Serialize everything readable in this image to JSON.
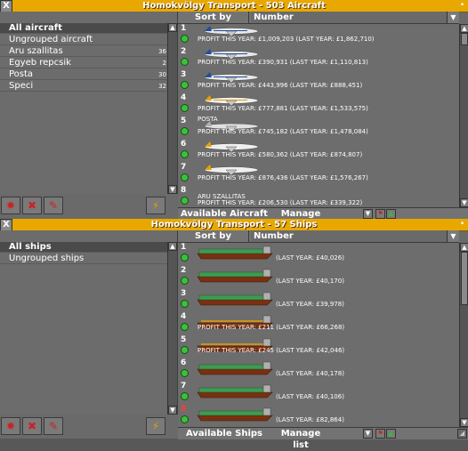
{
  "aircraft_window": {
    "title": "Homokvölgy Transport - 503 Aircraft",
    "close": "X",
    "pin": "•",
    "groups": [
      {
        "label": "All aircraft",
        "count": ""
      },
      {
        "label": "Ungrouped aircraft",
        "count": ""
      },
      {
        "label": "Aru szallitas",
        "count": "36"
      },
      {
        "label": "Egyeb repcsik",
        "count": "2"
      },
      {
        "label": "Posta",
        "count": "30"
      },
      {
        "label": "Speci",
        "count": "32"
      }
    ],
    "sort_by_label": "Sort by",
    "sort_value": "Number",
    "vehicles": [
      {
        "num": "1",
        "profit": "PROFIT THIS YEAR: £1,009,203 (LAST YEAR: £1,862,710)",
        "tag": ""
      },
      {
        "num": "2",
        "profit": "PROFIT THIS YEAR: £390,931 (LAST YEAR: £1,110,813)",
        "tag": ""
      },
      {
        "num": "3",
        "profit": "PROFIT THIS YEAR: £443,996 (LAST YEAR: £888,451)",
        "tag": ""
      },
      {
        "num": "4",
        "profit": "PROFIT THIS YEAR: £777,881 (LAST YEAR: £1,533,575)",
        "tag": ""
      },
      {
        "num": "5",
        "profit": "PROFIT THIS YEAR: £745,182 (LAST YEAR: £1,478,084)",
        "tag": "POSTA"
      },
      {
        "num": "6",
        "profit": "PROFIT THIS YEAR: £580,362 (LAST YEAR: £874,807)",
        "tag": ""
      },
      {
        "num": "7",
        "profit": "PROFIT THIS YEAR: £876,436 (LAST YEAR: £1,576,267)",
        "tag": ""
      },
      {
        "num": "8",
        "profit": "PROFIT THIS YEAR: £206,530 (LAST YEAR: £339,322)",
        "tag": "ARU SZALLITAS"
      }
    ],
    "available_label": "Available Aircraft",
    "manage_label": "Manage list"
  },
  "ships_window": {
    "title": "Homokvölgy Transport - 57 Ships",
    "close": "X",
    "pin": "•",
    "groups": [
      {
        "label": "All ships",
        "count": ""
      },
      {
        "label": "Ungrouped ships",
        "count": ""
      }
    ],
    "sort_by_label": "Sort by",
    "sort_value": "Number",
    "vehicles": [
      {
        "num": "1",
        "red": false,
        "profit": "(LAST YEAR: £40,026)"
      },
      {
        "num": "2",
        "red": false,
        "profit": "(LAST YEAR: £40,170)"
      },
      {
        "num": "3",
        "red": false,
        "profit": "(LAST YEAR: £39,978)"
      },
      {
        "num": "4",
        "red": false,
        "profit": "PROFIT THIS YEAR: £211 (LAST YEAR: £66,268)"
      },
      {
        "num": "5",
        "red": false,
        "profit": "PROFIT THIS YEAR: £245 (LAST YEAR: £42,046)"
      },
      {
        "num": "6",
        "red": false,
        "profit": "(LAST YEAR: £40,178)"
      },
      {
        "num": "7",
        "red": false,
        "profit": "(LAST YEAR: £40,106)"
      },
      {
        "num": "8",
        "red": true,
        "profit": "(LAST YEAR: £82,864)"
      }
    ],
    "available_label": "Available Ships",
    "manage_label": "Manage list"
  },
  "colors": {
    "titlebar": "#e8a800",
    "panel": "#6a6a6a",
    "ok_light": "#39c239"
  }
}
